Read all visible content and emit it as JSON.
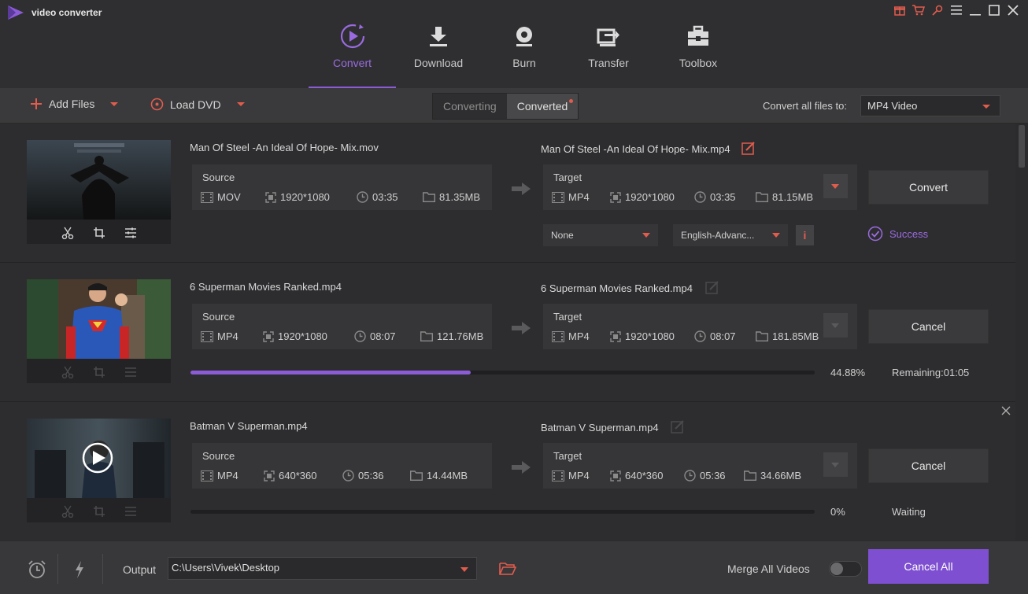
{
  "app": {
    "title": "video converter"
  },
  "nav": [
    {
      "label": "Convert",
      "icon": "convert-icon",
      "active": true
    },
    {
      "label": "Download",
      "icon": "download-icon"
    },
    {
      "label": "Burn",
      "icon": "burn-icon"
    },
    {
      "label": "Transfer",
      "icon": "transfer-icon"
    },
    {
      "label": "Toolbox",
      "icon": "toolbox-icon"
    }
  ],
  "toolbar": {
    "add_files": "Add Files",
    "load_dvd": "Load DVD",
    "tab_converting": "Converting",
    "tab_converted": "Converted",
    "convert_all_label": "Convert all files to:",
    "format": "MP4 Video"
  },
  "files": [
    {
      "source_name": "Man Of Steel -An Ideal Of Hope- Mix.mov",
      "target_name": "Man Of Steel -An Ideal Of Hope- Mix.mp4",
      "source": {
        "title": "Source",
        "format": "MOV",
        "resolution": "1920*1080",
        "duration": "03:35",
        "size": "81.35MB"
      },
      "target": {
        "title": "Target",
        "format": "MP4",
        "resolution": "1920*1080",
        "duration": "03:35",
        "size": "81.15MB"
      },
      "subtitle": "None",
      "audio": "English-Advanc...",
      "action": "Convert",
      "status": "Success"
    },
    {
      "source_name": "6 Superman Movies Ranked.mp4",
      "target_name": "6 Superman Movies Ranked.mp4",
      "source": {
        "title": "Source",
        "format": "MP4",
        "resolution": "1920*1080",
        "duration": "08:07",
        "size": "121.76MB"
      },
      "target": {
        "title": "Target",
        "format": "MP4",
        "resolution": "1920*1080",
        "duration": "08:07",
        "size": "181.85MB"
      },
      "action": "Cancel",
      "progress": 0.4488,
      "progress_text": "44.88%",
      "remaining": "Remaining:01:05"
    },
    {
      "source_name": "Batman V Superman.mp4",
      "target_name": "Batman V Superman.mp4",
      "source": {
        "title": "Source",
        "format": "MP4",
        "resolution": "640*360",
        "duration": "05:36",
        "size": "14.44MB"
      },
      "target": {
        "title": "Target",
        "format": "MP4",
        "resolution": "640*360",
        "duration": "05:36",
        "size": "34.66MB"
      },
      "action": "Cancel",
      "progress": 0,
      "progress_text": "0%",
      "remaining": "Waiting"
    }
  ],
  "footer": {
    "output_label": "Output",
    "output_path": "C:\\Users\\Vivek\\Desktop",
    "merge_label": "Merge All Videos",
    "merge_on": false,
    "cancel_all": "Cancel All"
  },
  "colors": {
    "accent": "#8b5cd6",
    "warning": "#e25c4d"
  }
}
